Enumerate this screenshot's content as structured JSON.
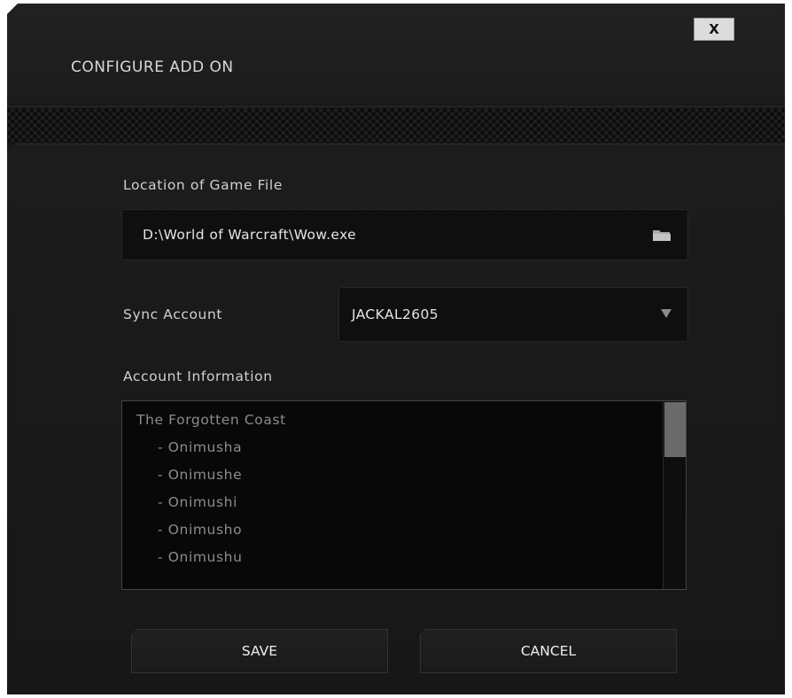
{
  "dialog": {
    "title": "CONFIGURE ADD ON",
    "close_label": "X"
  },
  "game_file": {
    "label": "Location of Game File",
    "path": "D:\\World of Warcraft\\Wow.exe",
    "browse_icon": "folder-icon"
  },
  "sync_account": {
    "label": "Sync Account",
    "selected": "JACKAL2605",
    "dropdown_icon": "chevron-down-icon"
  },
  "account_info": {
    "label": "Account Information",
    "items": [
      "The Forgotten Coast",
      "- Onimusha",
      "- Onimushe",
      "- Onimushi",
      "- Onimusho",
      "- Onimushu"
    ]
  },
  "actions": {
    "save_label": "SAVE",
    "cancel_label": "CANCEL"
  },
  "colors": {
    "background": "#161616",
    "text": "#d0d0d0",
    "muted_text": "#8c8c8c",
    "field": "#0f0f0f"
  }
}
